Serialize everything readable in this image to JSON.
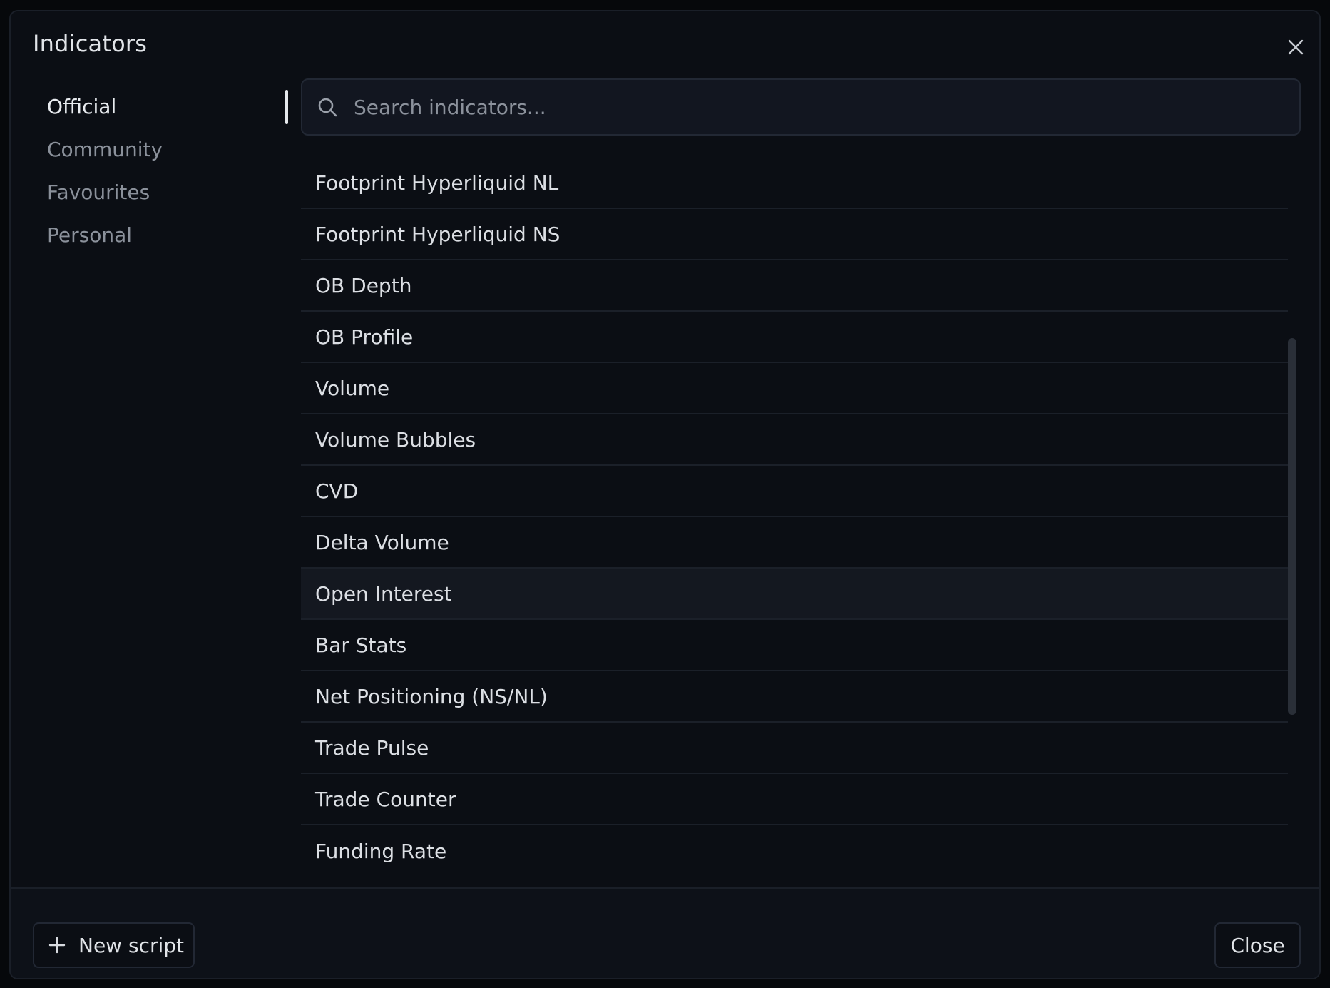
{
  "dialog": {
    "title": "Indicators",
    "close_icon": "close-icon"
  },
  "sidebar": {
    "items": [
      {
        "label": "Official",
        "active": true
      },
      {
        "label": "Community",
        "active": false
      },
      {
        "label": "Favourites",
        "active": false
      },
      {
        "label": "Personal",
        "active": false
      }
    ]
  },
  "search": {
    "placeholder": "Search indicators...",
    "value": "",
    "icon": "search-icon"
  },
  "indicators": {
    "items": [
      "Footprint Hyperliquid NL",
      "Footprint Hyperliquid NS",
      "OB Depth",
      "OB Profile",
      "Volume",
      "Volume Bubbles",
      "CVD",
      "Delta Volume",
      "Open Interest",
      "Bar Stats",
      "Net Positioning (NS/NL)",
      "Trade Pulse",
      "Trade Counter",
      "Funding Rate"
    ],
    "hovered": "Open Interest"
  },
  "footer": {
    "new_script_label": "New script",
    "new_script_icon": "plus-icon",
    "close_label": "Close"
  },
  "colors": {
    "background": "#0b0e14",
    "text": "#dcdfe4",
    "muted": "#8b919b",
    "border": "#1b2029"
  }
}
